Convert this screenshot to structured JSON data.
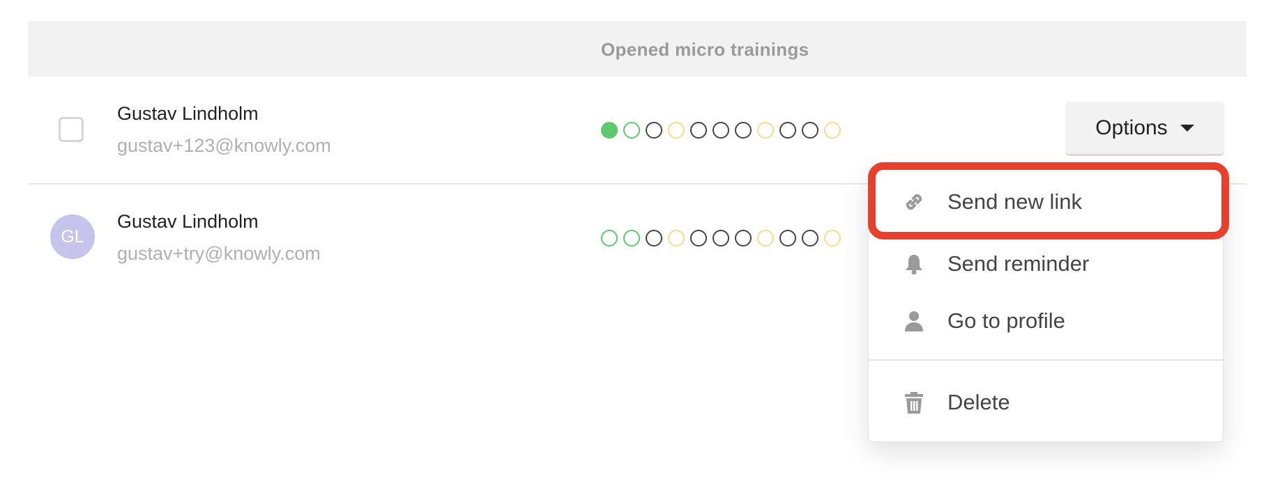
{
  "table": {
    "header_label": "Opened micro trainings"
  },
  "rows": [
    {
      "name": "Gustav Lindholm",
      "email": "gustav+123@knowly.com",
      "dots": [
        "#5cc96d-filled",
        "#5cc96d",
        "#444444",
        "#f6dd8a",
        "#444444",
        "#444444",
        "#444444",
        "#f6dd8a",
        "#444444",
        "#444444",
        "#f6dd8a"
      ]
    },
    {
      "name": "Gustav Lindholm",
      "email": "gustav+try@knowly.com",
      "avatar_initials": "GL",
      "dots": [
        "#5cc96d",
        "#5cc96d",
        "#444444",
        "#f6dd8a",
        "#444444",
        "#444444",
        "#444444",
        "#f6dd8a",
        "#444444",
        "#444444",
        "#f6dd8a"
      ]
    }
  ],
  "options": {
    "label": "Options",
    "icon": "caret-down-icon"
  },
  "menu": {
    "items": [
      {
        "label": "Send new link",
        "icon": "link-icon"
      },
      {
        "label": "Send reminder",
        "icon": "bell-icon"
      },
      {
        "label": "Go to profile",
        "icon": "person-icon"
      },
      {
        "label": "Delete",
        "icon": "trash-icon"
      }
    ]
  },
  "colors": {
    "highlight": "#e8402d",
    "green": "#5cc96d",
    "yellow": "#f6dd8a",
    "dark": "#444444",
    "avatar": "#c6c3ec"
  }
}
